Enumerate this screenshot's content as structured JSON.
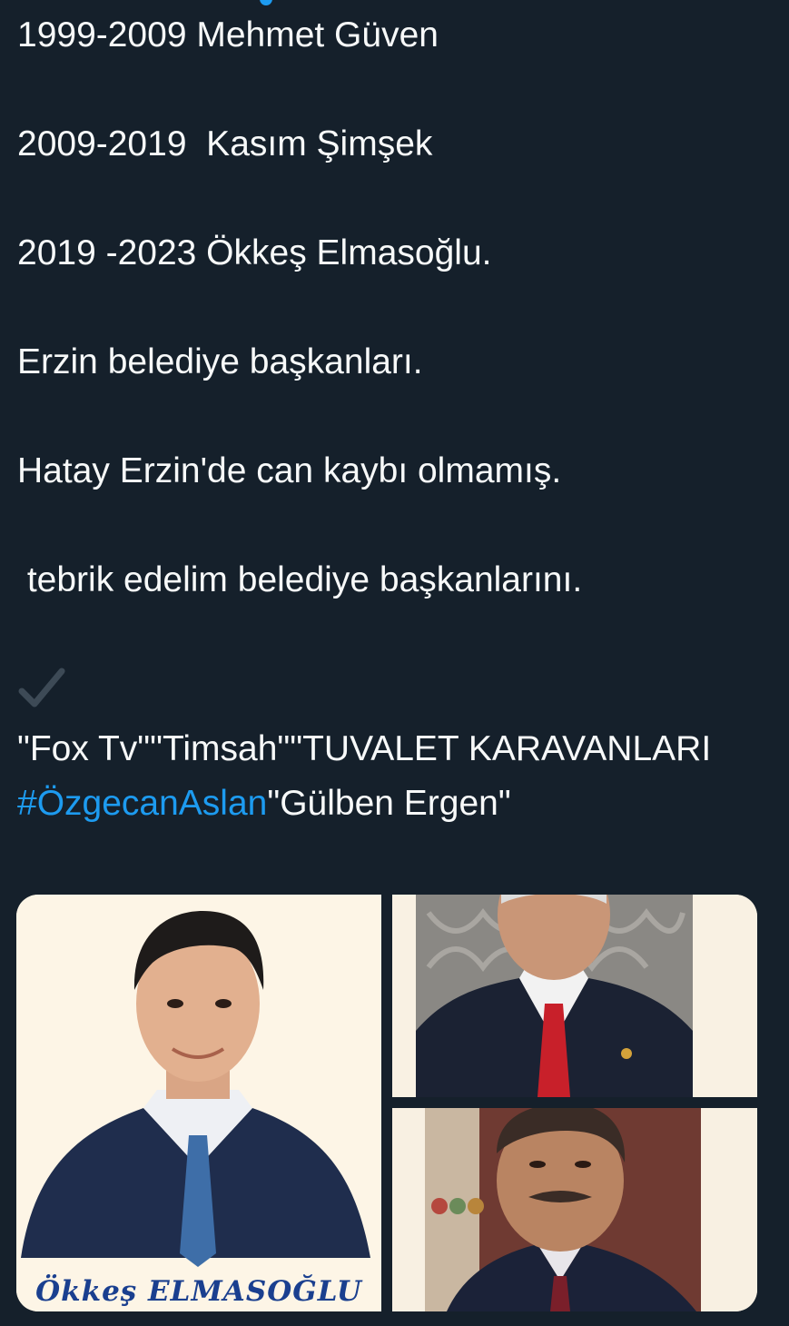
{
  "tweet": {
    "lines": [
      "1999-2009 Mehmet Güven",
      "2009-2019  Kasım Şimşek",
      "2019 -2023 Ökkeş Elmasoğlu.",
      "Erzin belediye başkanları.",
      "Hatay Erzin'de can kaybı olmamış.",
      " tebrik edelim belediye başkanlarını."
    ],
    "check_icon": "check-icon",
    "quote_before": "\"Fox Tv\"\"Timsah\"\"TUVALET KARAVANLARI ",
    "hashtag": "#ÖzgecanAslan",
    "quote_after": "\"Gülben Ergen\""
  },
  "media": {
    "caption": "Ökkeş ELMASOĞLU"
  },
  "colors": {
    "background": "#15202b",
    "text": "#f7f9f9",
    "link": "#1d9bf0",
    "caption": "#1a3f8f"
  }
}
